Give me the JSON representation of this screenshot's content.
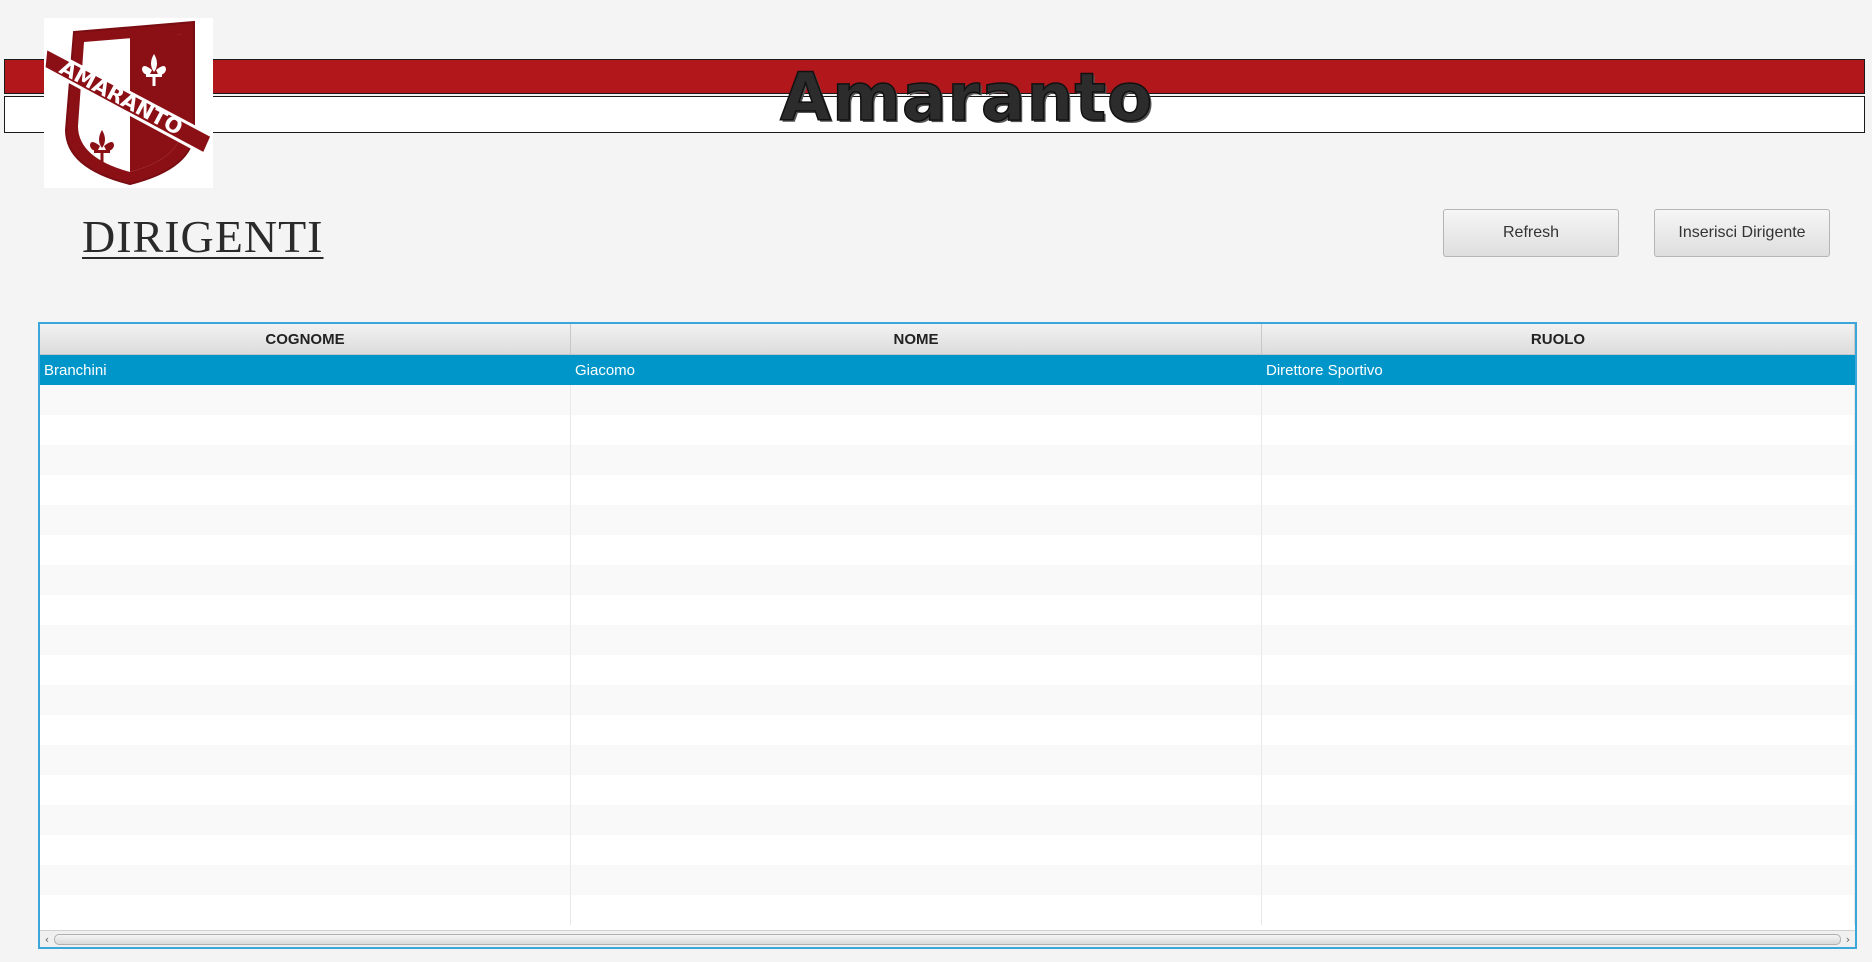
{
  "header": {
    "brand": "Amaranto",
    "logo_text": "AMARANTO"
  },
  "section": {
    "title": "DIRIGENTI"
  },
  "toolbar": {
    "refresh_label": "Refresh",
    "insert_label": "Inserisci Dirigente"
  },
  "table": {
    "columns": [
      "COGNOME",
      "NOME",
      "RUOLO"
    ],
    "rows": [
      [
        "Branchini",
        "Giacomo",
        "Direttore Sportivo"
      ]
    ]
  },
  "colors": {
    "brand_red": "#b2171b",
    "selection": "#0096c9",
    "table_border": "#3aa6d9"
  },
  "icons": {
    "logo": "fleur-de-lis-shield-icon",
    "scroll_left": "chevron-left-icon",
    "scroll_right": "chevron-right-icon"
  }
}
